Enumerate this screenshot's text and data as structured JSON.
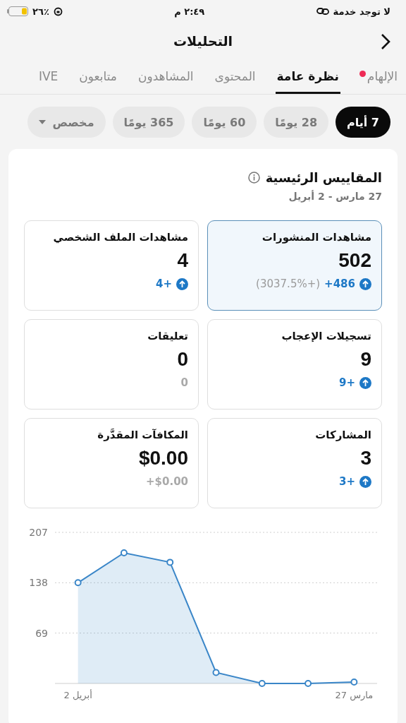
{
  "status_bar": {
    "carrier": "لا توجد خدمة",
    "time": "٢:٤٩ م",
    "battery": "٪٢٦"
  },
  "header": {
    "title": "التحليلات"
  },
  "tabs": [
    {
      "label": "الإلهام",
      "selected": false,
      "dot": true
    },
    {
      "label": "نظرة عامة",
      "selected": true,
      "dot": false
    },
    {
      "label": "المحتوى",
      "selected": false,
      "dot": false
    },
    {
      "label": "المشاهدون",
      "selected": false,
      "dot": false
    },
    {
      "label": "متابعون",
      "selected": false,
      "dot": false
    },
    {
      "label": "IVE",
      "selected": false,
      "dot": false
    }
  ],
  "periods": [
    {
      "label": "7 أيام",
      "selected": true,
      "kind": "pill"
    },
    {
      "label": "28 يومًا",
      "selected": false,
      "kind": "pill"
    },
    {
      "label": "60 يومًا",
      "selected": false,
      "kind": "pill"
    },
    {
      "label": "365 يومًا",
      "selected": false,
      "kind": "pill"
    },
    {
      "label": "مخصص",
      "selected": false,
      "kind": "dropdown"
    }
  ],
  "metrics_panel": {
    "title": "المقاييس الرئيسية",
    "date_range": "27 مارس - 2 أبريل",
    "metrics": [
      {
        "title": "مشاهدات المنشورات",
        "value": "502",
        "change": "+486",
        "percent": "(3037.5%+)",
        "kind": "up",
        "selected": true
      },
      {
        "title": "مشاهدات الملف الشخصي",
        "value": "4",
        "change": "4+",
        "kind": "up",
        "selected": false
      },
      {
        "title": "تسجيلات الإعجاب",
        "value": "9",
        "change": "9+",
        "kind": "up",
        "selected": false
      },
      {
        "title": "تعليقات",
        "value": "0",
        "change": "0",
        "kind": "flat",
        "selected": false
      },
      {
        "title": "المشاركات",
        "value": "3",
        "change": "3+",
        "kind": "up",
        "selected": false
      },
      {
        "title": "المكافآت المقدَّرة",
        "value": "$0.00",
        "change": "+$0.00",
        "kind": "flat",
        "selected": false
      }
    ],
    "chart_data": {
      "type": "area",
      "categories": [
        "2 أبريل",
        null,
        null,
        null,
        null,
        null,
        "27 مارس"
      ],
      "ylim": [
        0,
        207
      ],
      "yticks": [
        69,
        138,
        207
      ],
      "series": [
        {
          "color": "#3a86c8",
          "values": [
            138,
            179,
            166,
            15,
            0,
            0,
            2
          ]
        }
      ]
    }
  }
}
